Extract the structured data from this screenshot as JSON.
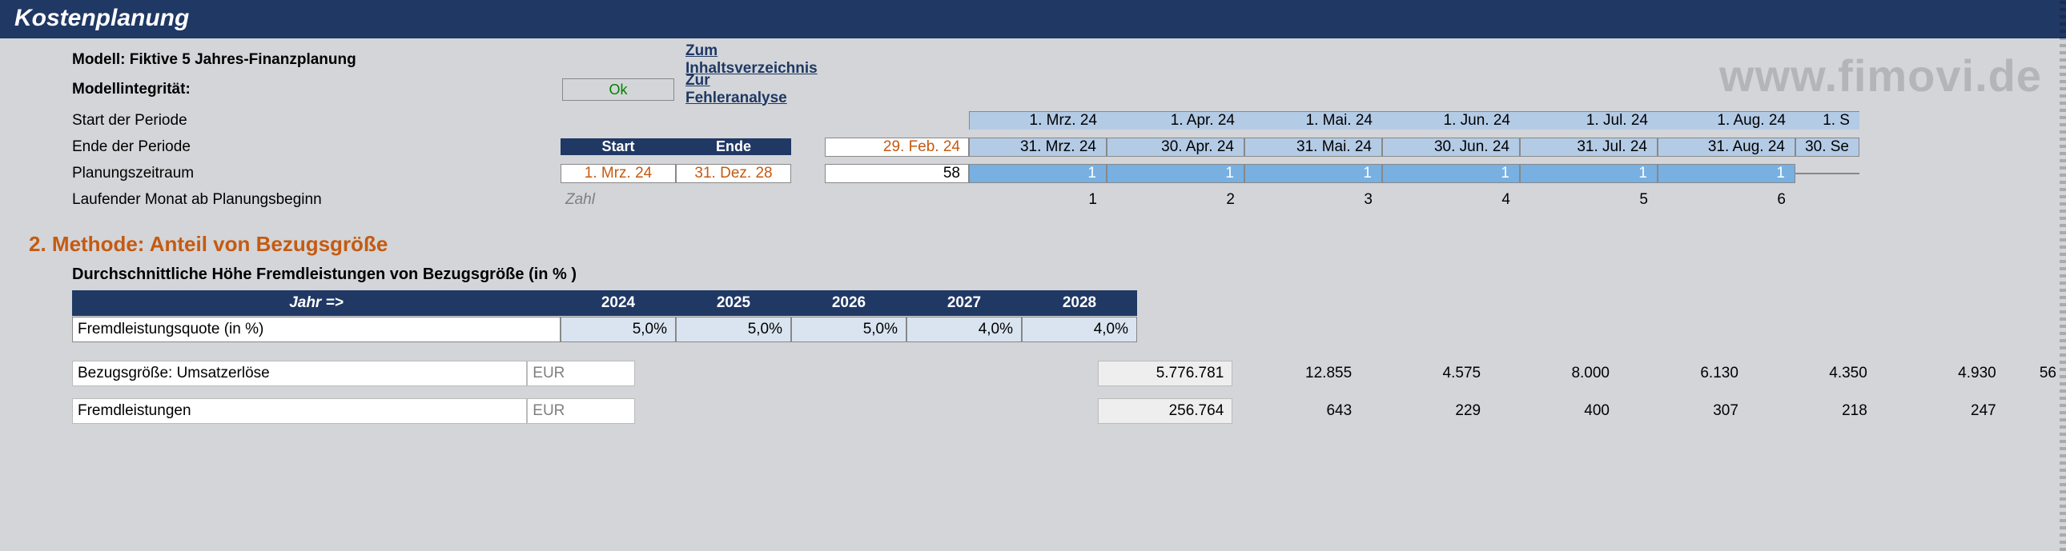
{
  "title": "Kostenplanung",
  "watermark": "www.fimovi.de",
  "header": {
    "model_label": "Modell: Fiktive 5 Jahres-Finanzplanung",
    "link_toc": "Zum Inhaltsverzeichnis",
    "integrity_label": "Modellintegrität:",
    "integrity_status": "Ok",
    "link_errors": "Zur Fehleranalyse",
    "period_start_label": "Start der Periode",
    "period_end_label": "Ende der Periode",
    "start_header": "Start",
    "end_header": "Ende",
    "plan_label": "Planungszeitraum",
    "plan_start": "1. Mrz. 24",
    "plan_end": "31. Dez. 28",
    "month_idx_label": "Laufender Monat ab Planungsbeginn",
    "zahl": "Zahl",
    "total_end": "29. Feb. 24",
    "total_count": "58",
    "months_start": [
      "1. Mrz. 24",
      "1. Apr. 24",
      "1. Mai. 24",
      "1. Jun. 24",
      "1. Jul. 24",
      "1. Aug. 24",
      "1. S"
    ],
    "months_end": [
      "31. Mrz. 24",
      "30. Apr. 24",
      "31. Mai. 24",
      "30. Jun. 24",
      "31. Jul. 24",
      "31. Aug. 24",
      "30. Se"
    ],
    "ones": [
      "1",
      "1",
      "1",
      "1",
      "1",
      "1",
      ""
    ],
    "idx": [
      "1",
      "2",
      "3",
      "4",
      "5",
      "6",
      ""
    ]
  },
  "section": {
    "title": "2. Methode: Anteil von Bezugsgröße",
    "subtitle": "Durchschnittliche Höhe Fremdleistungen von Bezugsgröße (in % )",
    "year_label": "Jahr =>",
    "years": [
      "2024",
      "2025",
      "2026",
      "2027",
      "2028"
    ],
    "quote_label": "Fremdleistungsquote (in %)",
    "quotes": [
      "5,0%",
      "5,0%",
      "5,0%",
      "4,0%",
      "4,0%"
    ],
    "bezug_label": "Bezugsgröße: Umsatzerlöse",
    "bezug_curr": "EUR",
    "bezug_total": "5.776.781",
    "bezug_vals": [
      "12.855",
      "4.575",
      "8.000",
      "6.130",
      "4.350",
      "4.930",
      "56"
    ],
    "fremd_label": "Fremdleistungen",
    "fremd_curr": "EUR",
    "fremd_total": "256.764",
    "fremd_vals": [
      "643",
      "229",
      "400",
      "307",
      "218",
      "247",
      ""
    ]
  }
}
